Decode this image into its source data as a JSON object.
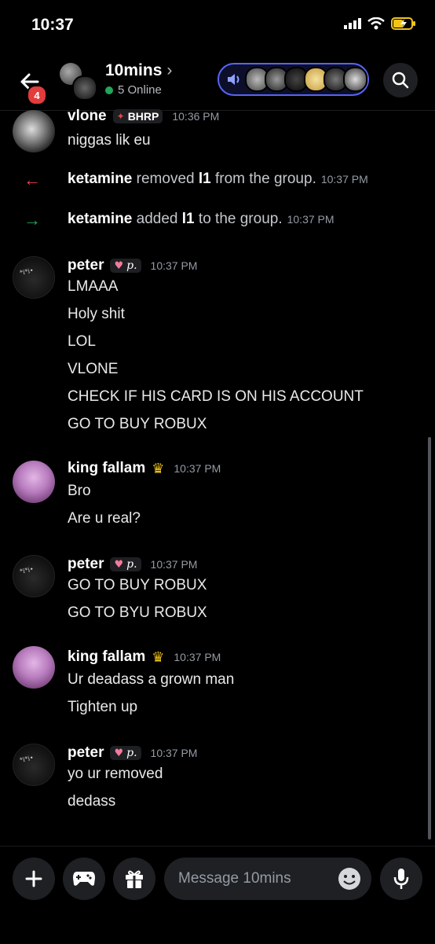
{
  "status_bar": {
    "time": "10:37"
  },
  "header": {
    "back_badge": "4",
    "group_name": "10mins",
    "online": "5 Online"
  },
  "messages": [
    {
      "user": "vlone",
      "tag": "BHRP",
      "time": "10:36 PM",
      "lines": [
        "niggas lik eu"
      ]
    },
    {
      "user": "peter",
      "tag": "p.",
      "time": "10:37 PM",
      "lines": [
        "LMAAA",
        "Holy shit",
        "LOL",
        "VLONE",
        "CHECK IF HIS CARD IS ON HIS ACCOUNT",
        "GO TO BUY ROBUX"
      ]
    },
    {
      "user": "king fallam",
      "time": "10:37 PM",
      "lines": [
        "Bro",
        "Are u real?"
      ]
    },
    {
      "user": "peter",
      "tag": "p.",
      "time": "10:37 PM",
      "lines": [
        "GO TO BUY ROBUX",
        "GO TO BYU ROBUX"
      ]
    },
    {
      "user": "king fallam",
      "time": "10:37 PM",
      "lines": [
        "Ur deadass a grown man",
        "Tighten up"
      ]
    },
    {
      "user": "peter",
      "tag": "p.",
      "time": "10:37 PM",
      "lines": [
        "yo ur removed",
        "dedass"
      ]
    }
  ],
  "system": [
    {
      "actor": "ketamine",
      "pre": "removed ",
      "target": "l1",
      "post": " from the group.",
      "time": "10:37 PM",
      "color": "#f23f43"
    },
    {
      "actor": "ketamine",
      "pre": "added ",
      "target": "l1",
      "post": " to the group.",
      "time": "10:37 PM",
      "color": "#23a55a"
    }
  ],
  "composer": {
    "placeholder": "Message 10mins"
  },
  "colors": {
    "accent": "#5865f2",
    "online": "#23a55a",
    "badge": "#e23c3c"
  }
}
